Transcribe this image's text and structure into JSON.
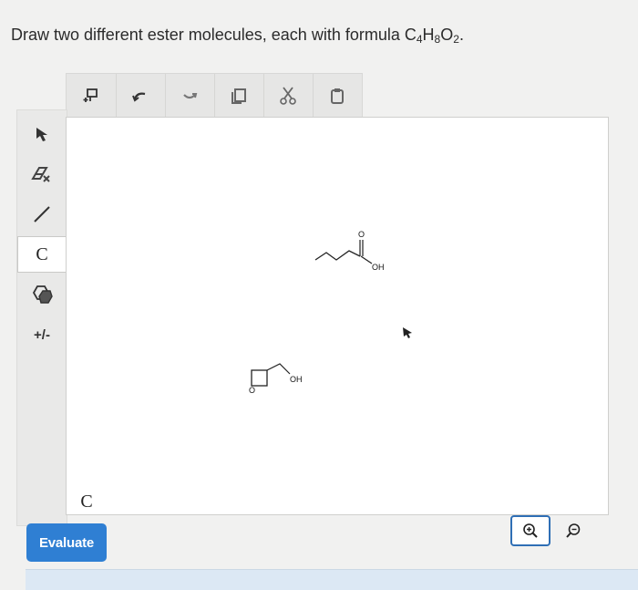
{
  "question": {
    "text_before": "Draw two different ester molecules, each with formula C",
    "sub1": "4",
    "mid1": "H",
    "sub2": "8",
    "mid2": "O",
    "sub3": "2",
    "text_after": "."
  },
  "top_toolbar": {
    "tools": [
      {
        "name": "template-insert-icon"
      },
      {
        "name": "undo-icon"
      },
      {
        "name": "redo-icon"
      },
      {
        "name": "copy-icon"
      },
      {
        "name": "cut-icon"
      },
      {
        "name": "paste-icon"
      }
    ]
  },
  "side_toolbar": {
    "tools": [
      {
        "name": "select-arrow-icon"
      },
      {
        "name": "eraser-icon"
      },
      {
        "name": "bond-line-icon"
      },
      {
        "name": "carbon-atom-button",
        "label": "C"
      },
      {
        "name": "ring-template-icon"
      },
      {
        "name": "charge-icon",
        "label": "+/-"
      }
    ],
    "element_label": "C"
  },
  "canvas": {
    "molecule1": {
      "oxygen_label": "O",
      "hydroxyl_label": "OH"
    },
    "molecule2": {
      "oxygen_label": "O",
      "hydroxyl_label": "OH"
    }
  },
  "buttons": {
    "evaluate": "Evaluate",
    "zoom_in_icon": "zoom-in-icon",
    "zoom_out_icon": "zoom-out-icon"
  },
  "colors": {
    "accent": "#2f7fd3",
    "zoom_border": "#2f6fb5",
    "background": "#f1f1f0"
  }
}
